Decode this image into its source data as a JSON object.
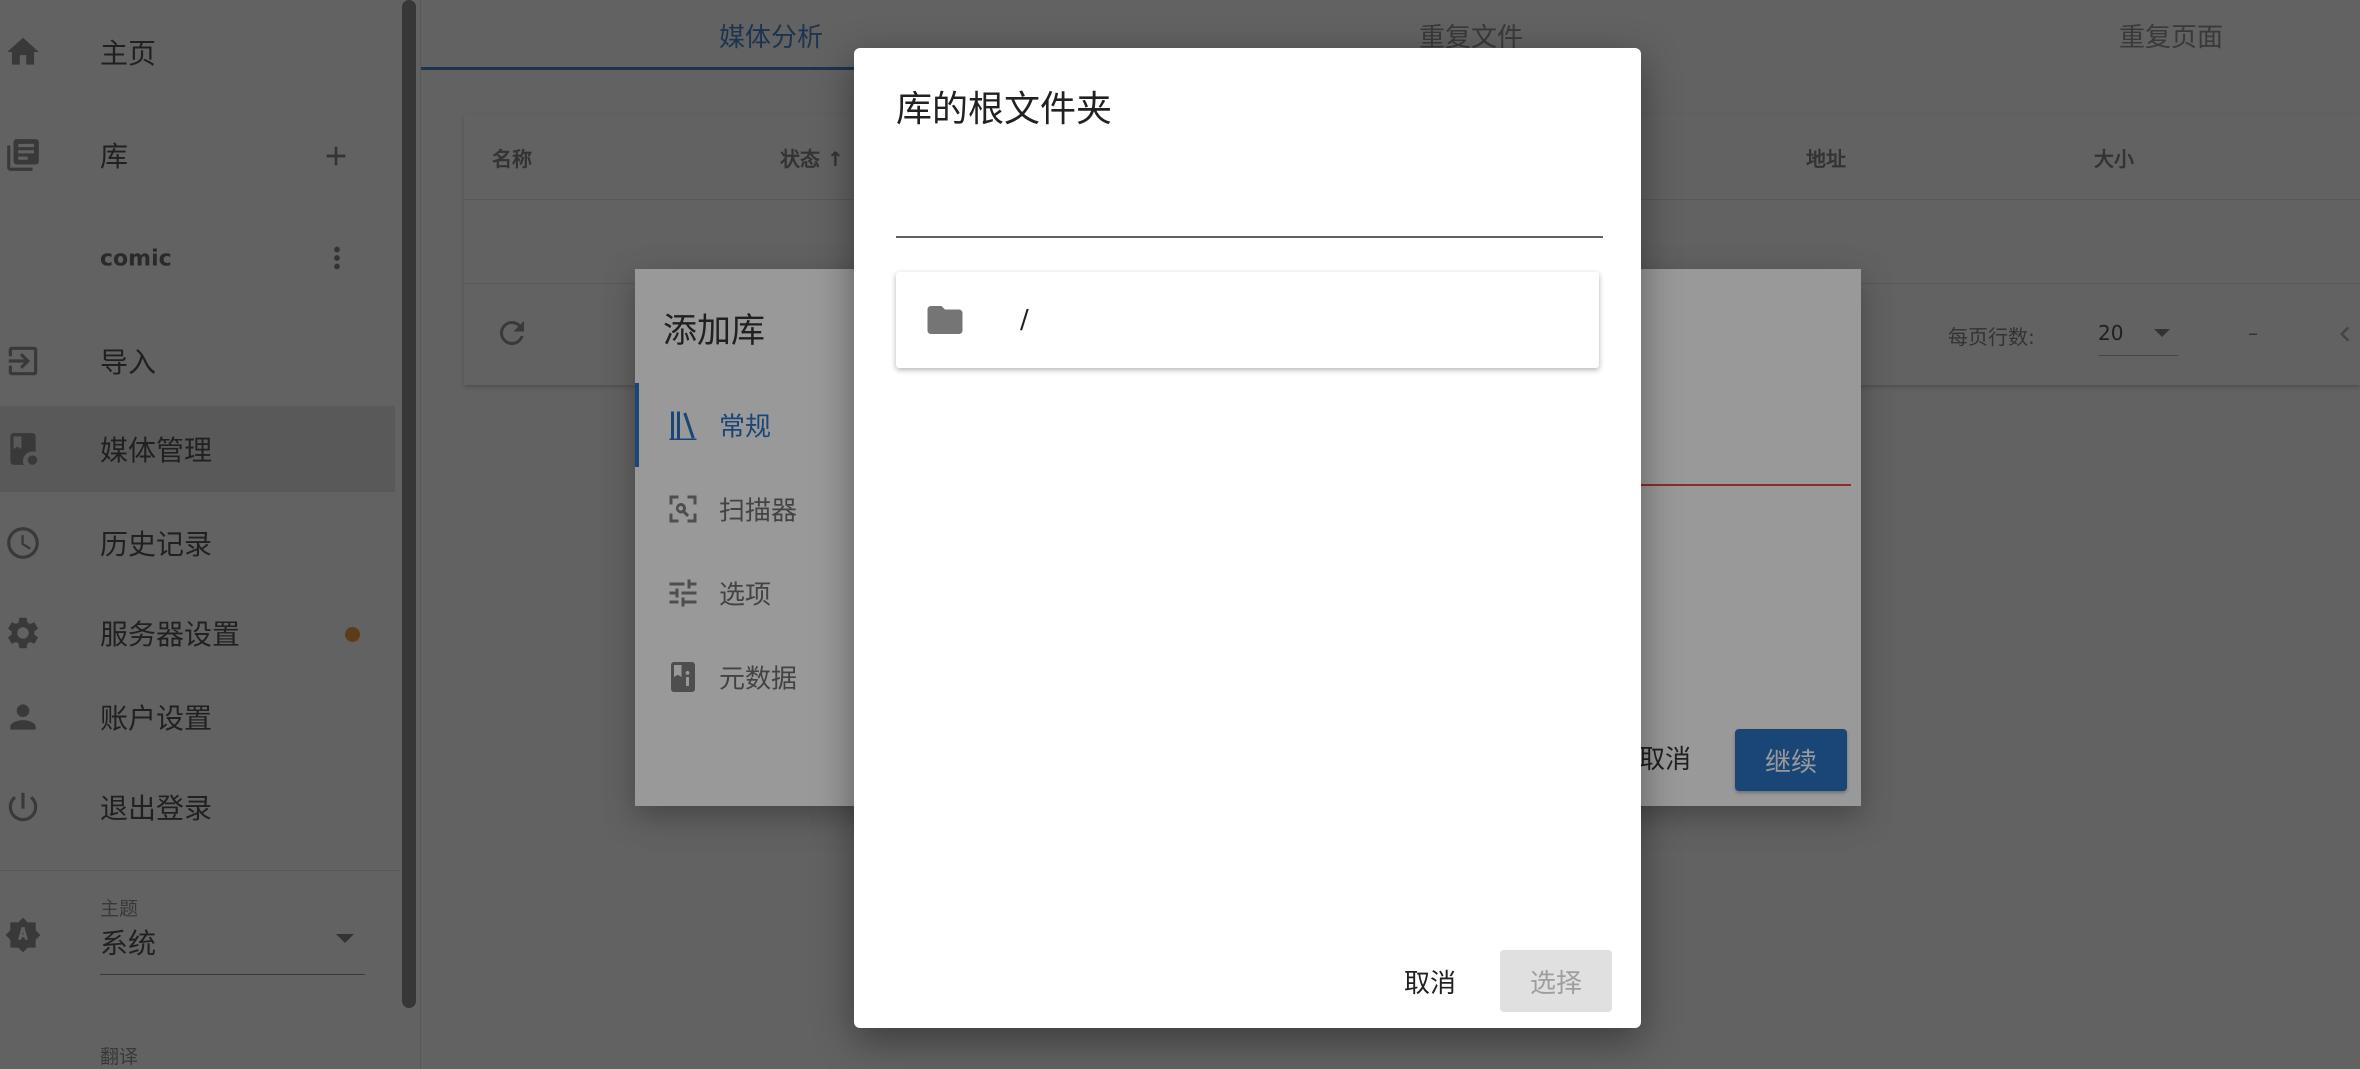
{
  "sidebar": {
    "home": "主页",
    "libraries": "库",
    "add_icon": "plus-icon",
    "library_item": "comic",
    "import": "导入",
    "media_management": "媒体管理",
    "history": "历史记录",
    "server_settings": "服务器设置",
    "account_settings": "账户设置",
    "logout": "退出登录",
    "theme_label": "主题",
    "theme_value": "系统",
    "translation_label": "翻译",
    "notification_dot_color": "#f57c00"
  },
  "tabs": [
    "媒体分析",
    "重复文件",
    "重复页面"
  ],
  "table": {
    "headers": {
      "name": "名称",
      "status": "状态 ↑",
      "url": "地址",
      "size": "大小"
    },
    "rows_per_page_label": "每页行数:",
    "rows_per_page_value": "20",
    "range_text": "–"
  },
  "add_library_dialog": {
    "title": "添加库",
    "tabs": [
      {
        "label": "常规",
        "icon": "library-books-icon"
      },
      {
        "label": "扫描器",
        "icon": "scan-search-icon"
      },
      {
        "label": "选项",
        "icon": "tune-sliders-icon"
      },
      {
        "label": "元数据",
        "icon": "book-info-icon"
      }
    ],
    "cancel": "取消",
    "continue": "继续"
  },
  "folder_dialog": {
    "title": "库的根文件夹",
    "input_value": "",
    "folders": [
      "/"
    ],
    "cancel": "取消",
    "select": "选择"
  },
  "colors": {
    "primary": "#1565c0",
    "error": "#e53935"
  }
}
